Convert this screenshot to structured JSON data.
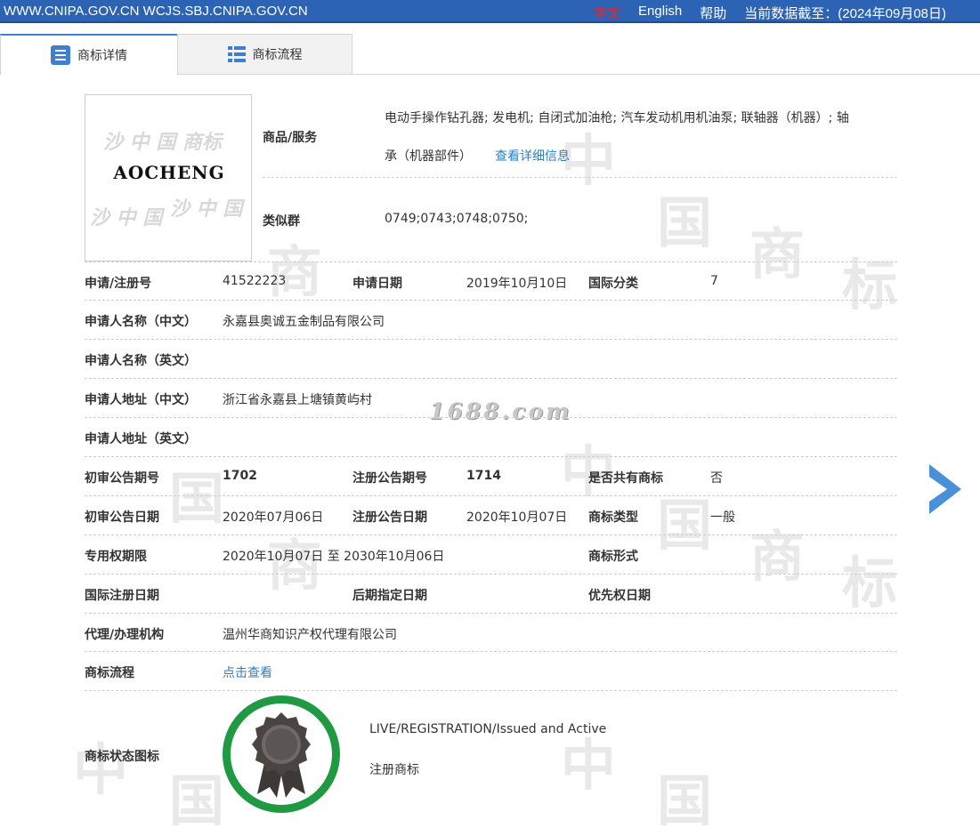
{
  "topbar": {
    "site": "WWW.CNIPA.GOV.CN WCJS.SBJ.CNIPA.GOV.CN",
    "lang_cn": "中文",
    "lang_en": "English",
    "help": "帮助",
    "data_date": "当前数据截至：(2024年09月08日)"
  },
  "tabs": [
    {
      "label": "商标详情",
      "icon": "list-icon"
    },
    {
      "label": "商标流程",
      "icon": "grid-list-icon"
    }
  ],
  "logo": {
    "text": "AOCHENG"
  },
  "watermark": "1688.com",
  "goods": {
    "label": "商品/服务",
    "line1": "电动手操作钻孔器; 发电机; 自闭式加油枪; 汽车发动机用机油泵; 联轴器（机器）; 轴",
    "line2": "承（机器部件）",
    "link": "查看详细信息"
  },
  "similar": {
    "label": "类似群",
    "value": "0749;0743;0748;0750;"
  },
  "rows": {
    "reg_no_label": "申请/注册号",
    "reg_no": "41522223",
    "app_date_label": "申请日期",
    "app_date": "2019年10月10日",
    "intl_class_label": "国际分类",
    "intl_class": "7",
    "applicant_cn_label": "申请人名称（中文）",
    "applicant_cn": "永嘉县奥诚五金制品有限公司",
    "applicant_en_label": "申请人名称（英文）",
    "applicant_en": "",
    "addr_cn_label": "申请人地址（中文）",
    "addr_cn": "浙江省永嘉县上塘镇黄屿村",
    "addr_en_label": "申请人地址（英文）",
    "addr_en": "",
    "prelim_no_label": "初审公告期号",
    "prelim_no": "1702",
    "reg_pub_no_label": "注册公告期号",
    "reg_pub_no": "1714",
    "shared_label": "是否共有商标",
    "shared": "否",
    "prelim_date_label": "初审公告日期",
    "prelim_date": "2020年07月06日",
    "reg_pub_date_label": "注册公告日期",
    "reg_pub_date": "2020年10月07日",
    "tm_type_label": "商标类型",
    "tm_type": "一般",
    "term_label": "专用权期限",
    "term": "2020年10月07日 至 2030年10月06日",
    "tm_form_label": "商标形式",
    "tm_form": "",
    "intl_reg_date_label": "国际注册日期",
    "intl_reg_date": "",
    "later_desig_label": "后期指定日期",
    "later_desig": "",
    "priority_label": "优先权日期",
    "priority": "",
    "agent_label": "代理/办理机构",
    "agent": "温州华商知识产权代理有限公司",
    "flow_label": "商标流程",
    "flow_link": "点击查看",
    "status_label": "商标状态图标",
    "status_en": "LIVE/REGISTRATION/Issued and Active",
    "status_cn": "注册商标"
  },
  "colors": {
    "topbar": "#2d63b4",
    "accent": "#3f7fd0",
    "link": "#2b7fc8",
    "badge_ring": "#1f9a43",
    "lang_active": "#e8262a"
  }
}
